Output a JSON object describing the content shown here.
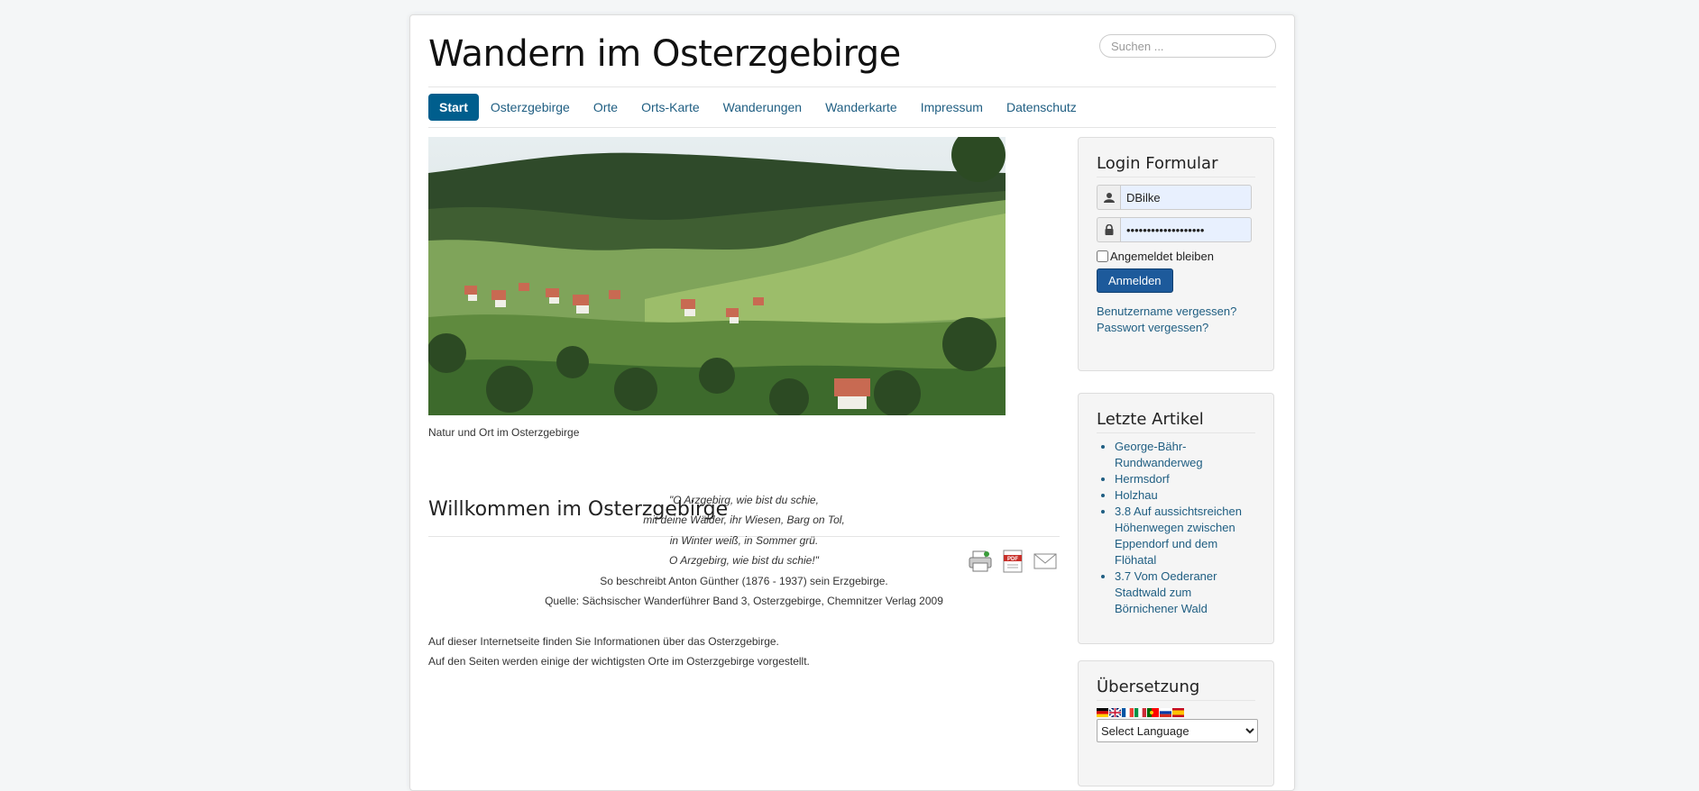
{
  "site": {
    "title": "Wandern im Osterzgebirge"
  },
  "search": {
    "placeholder": "Suchen ..."
  },
  "nav": [
    {
      "label": "Start"
    },
    {
      "label": "Osterzgebirge"
    },
    {
      "label": "Orte"
    },
    {
      "label": "Orts-Karte"
    },
    {
      "label": "Wanderungen"
    },
    {
      "label": "Wanderkarte"
    },
    {
      "label": "Impressum"
    },
    {
      "label": "Datenschutz"
    }
  ],
  "hero": {
    "caption": "Natur und Ort im Osterzgebirge"
  },
  "article": {
    "title": "Willkommen im Osterzgebirge",
    "quote": [
      "\"O Arzgebirg, wie bist du schie,",
      "mit deine Wälder, ihr Wiesen, Barg on Tol,",
      "in Winter weiß, in Sommer grü.",
      "O Arzgebirg, wie bist du schie!\""
    ],
    "attribution": "So beschreibt Anton Günther (1876 - 1937) sein Erzgebirge.",
    "source": "Quelle: Sächsischer Wanderführer Band 3, Osterzgebirge, Chemnitzer Verlag 2009",
    "p1": "Auf dieser Internetseite finden Sie Informationen über das Osterzgebirge.",
    "p2": "Auf den Seiten werden einige der wichtigsten Orte im Osterzgebirge vorgestellt."
  },
  "tool_icons": [
    "print-icon",
    "pdf-icon",
    "email-icon"
  ],
  "login": {
    "title": "Login Formular",
    "username": "DBilke",
    "password": "•••••••••••••••••••",
    "remember_label": "Angemeldet bleiben",
    "submit": "Anmelden",
    "forgot_user": "Benutzername vergessen?",
    "forgot_pass": "Passwort vergessen?"
  },
  "latest": {
    "title": "Letzte Artikel",
    "items": [
      {
        "label": "George-Bähr-Rundwanderweg"
      },
      {
        "label": "Hermsdorf"
      },
      {
        "label": "Holzhau"
      },
      {
        "label": "3.8 Auf aussichtsreichen Höhenwegen zwischen Eppendorf und dem Flöhatal"
      },
      {
        "label": "3.7 Vom Oederaner Stadtwald zum Börnichener Wald"
      }
    ]
  },
  "translation": {
    "title": "Übersetzung",
    "flags": [
      "de-flag",
      "en-flag",
      "fr-flag",
      "it-flag",
      "pt-flag",
      "ru-flag",
      "es-flag"
    ],
    "select": "Select Language"
  },
  "colors": {
    "accent": "#005e8d",
    "link": "#1f5e82",
    "button": "#1d5a9b"
  }
}
